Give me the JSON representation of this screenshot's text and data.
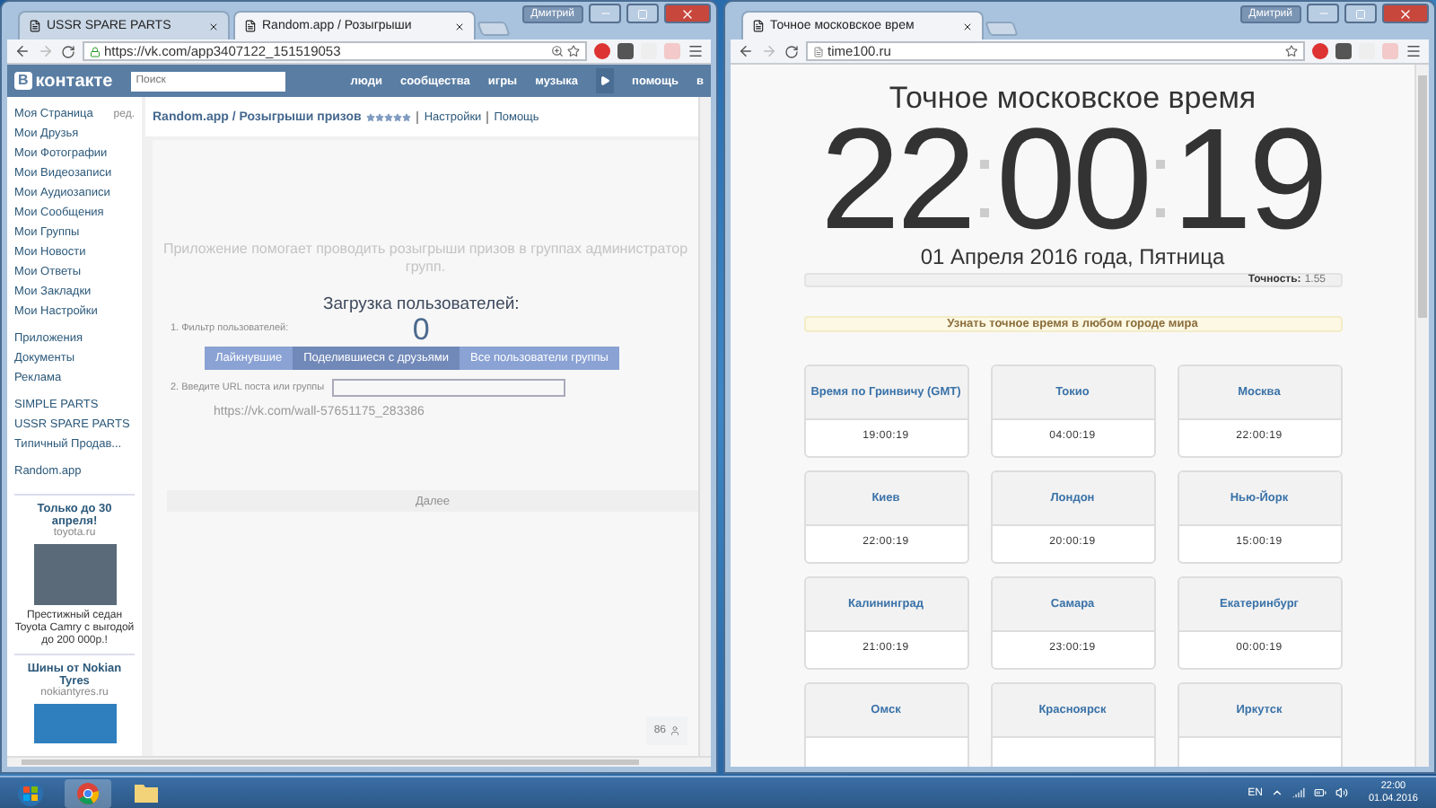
{
  "left_window": {
    "tabs": [
      {
        "title": "USSR SPARE PARTS",
        "selected": false
      },
      {
        "title": "Random.app / Розыгрыши",
        "selected": true
      }
    ],
    "profile": "Дмитрий",
    "url": "https://vk.com/app3407122_151519053",
    "site": {
      "logo_letter": "В",
      "logo_word": "контакте",
      "search": {
        "placeholder": "Поиск"
      },
      "nav": [
        {
          "kind": "link",
          "label": "люди"
        },
        {
          "kind": "link",
          "label": "сообщества"
        },
        {
          "kind": "link",
          "label": "игры"
        },
        {
          "kind": "link",
          "label": "музыка"
        },
        {
          "kind": "player"
        },
        {
          "kind": "link",
          "label": "помощь"
        },
        {
          "kind": "link",
          "label": "в"
        }
      ]
    },
    "sidebar": {
      "edit_label": "ред.",
      "groups": [
        [
          "Моя Страница",
          "Мои Друзья",
          "Мои Фотографии",
          "Мои Видеозаписи",
          "Мои Аудиозаписи",
          "Мои Сообщения",
          "Мои Группы",
          "Мои Новости",
          "Мои Ответы",
          "Мои Закладки",
          "Мои Настройки"
        ],
        [
          "Приложения",
          "Документы",
          "Реклама"
        ],
        [
          "SIMPLE PARTS",
          "USSR SPARE PARTS",
          "Типичный Продав..."
        ],
        [
          "Random.app"
        ]
      ]
    },
    "ads": [
      {
        "title": "Только до 30 апреля!",
        "domain": "toyota.ru",
        "text": "Престижный седан Toyota Camry с выгодой до 200 000р.!"
      },
      {
        "title": "Шины от Nokian Tyres",
        "domain": "nokiantyres.ru"
      }
    ],
    "app": {
      "breadcrumb": "Random.app / Розыгрыши призов",
      "stars": 5,
      "links": [
        "Настройки",
        "Помощь"
      ],
      "description": "Приложение помогает проводить розыгрыши призов в группах администратор групп.",
      "step1": "1. Фильтр пользователей:",
      "filters": [
        {
          "label": "Лайкнувшие",
          "selected": false
        },
        {
          "label": "Поделившиеся с друзьями",
          "selected": true
        },
        {
          "label": "Все пользователи группы",
          "selected": false
        }
      ],
      "step2": "2. Введите URL поста или группы",
      "url_value": "https://vk.com/wall-57651175_283386",
      "next": "Далее",
      "loading": {
        "title": "Загрузка пользователей:",
        "count": "0"
      },
      "online_count": "86"
    }
  },
  "right_window": {
    "tabs": [
      {
        "title": "Точное московское врем",
        "selected": true
      }
    ],
    "profile": "Дмитрий",
    "url": "time100.ru",
    "heading": "Точное московское время",
    "clock": [
      "22",
      "00",
      "19"
    ],
    "date": "01 Апреля 2016 года, Пятница",
    "accuracy": {
      "label": "Точность:",
      "value": "1.55"
    },
    "banner": "Узнать точное время в любом городе мира",
    "cities": [
      {
        "name": "Время по Гринвичу (GMT)",
        "time": "19:00:19"
      },
      {
        "name": "Токио",
        "time": "04:00:19"
      },
      {
        "name": "Москва",
        "time": "22:00:19"
      },
      {
        "name": "Киев",
        "time": "22:00:19"
      },
      {
        "name": "Лондон",
        "time": "20:00:19"
      },
      {
        "name": "Нью-Йорк",
        "time": "15:00:19"
      },
      {
        "name": "Калининград",
        "time": "21:00:19"
      },
      {
        "name": "Самара",
        "time": "23:00:19"
      },
      {
        "name": "Екатеринбург",
        "time": "00:00:19"
      },
      {
        "name": "Омск"
      },
      {
        "name": "Красноярск"
      },
      {
        "name": "Иркутск"
      }
    ]
  },
  "taskbar": {
    "language": "EN",
    "clock": {
      "time": "22:00",
      "date": "01.04.2016"
    }
  }
}
